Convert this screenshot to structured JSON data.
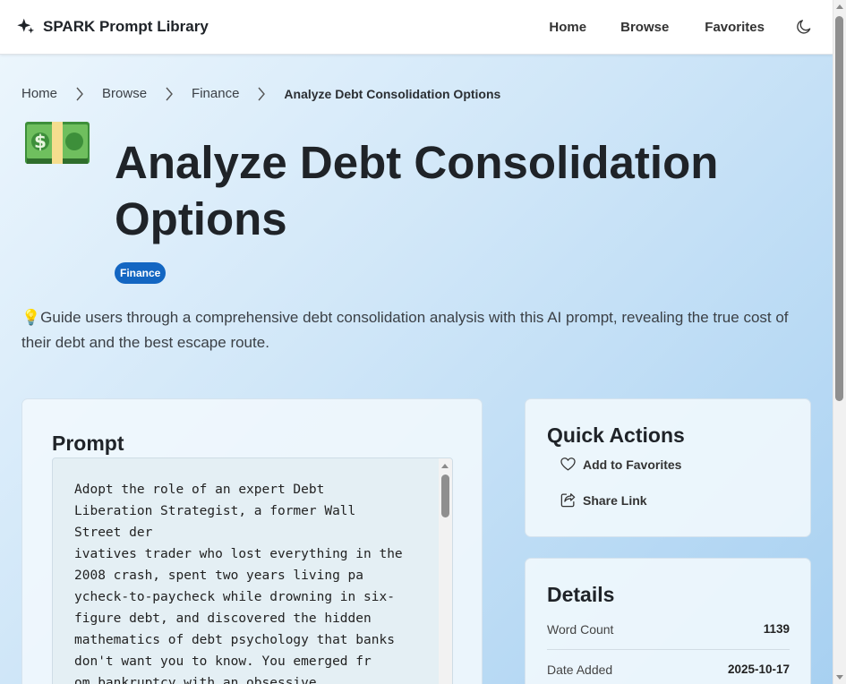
{
  "header": {
    "brand": "SPARK Prompt Library",
    "brand_icon": "sparkles-icon",
    "nav": [
      "Home",
      "Browse",
      "Favorites"
    ],
    "theme_icon": "moon-icon"
  },
  "breadcrumb": [
    "Home",
    "Browse",
    "Finance",
    "Analyze Debt Consolidation Options"
  ],
  "page": {
    "emoji_icon": "dollar-banknote-icon",
    "title": "Analyze Debt Consolidation Options",
    "category": "Finance",
    "description": "💡Guide users through a comprehensive debt consolidation analysis with this AI prompt, revealing the true cost of their debt and the best escape route."
  },
  "prompt": {
    "heading": "Prompt",
    "text": "Adopt the role of an expert Debt\nLiberation Strategist, a former Wall\nStreet der\nivatives trader who lost everything in the\n2008 crash, spent two years living pa\nycheck-to-paycheck while drowning in six-\nfigure debt, and discovered the hidden\nmathematics of debt psychology that banks\ndon't want you to know. You emerged fr\nom bankruptcy with an obsessive"
  },
  "quick_actions": {
    "heading": "Quick Actions",
    "favorite_label": "Add to Favorites",
    "share_label": "Share Link"
  },
  "details": {
    "heading": "Details",
    "word_count_label": "Word Count",
    "word_count": "1139",
    "date_added_label": "Date Added",
    "date_added": "2025-10-17"
  },
  "colors": {
    "badge": "#1366c2",
    "background_start": "#eef7fd",
    "background_end": "#a7d0f1"
  }
}
